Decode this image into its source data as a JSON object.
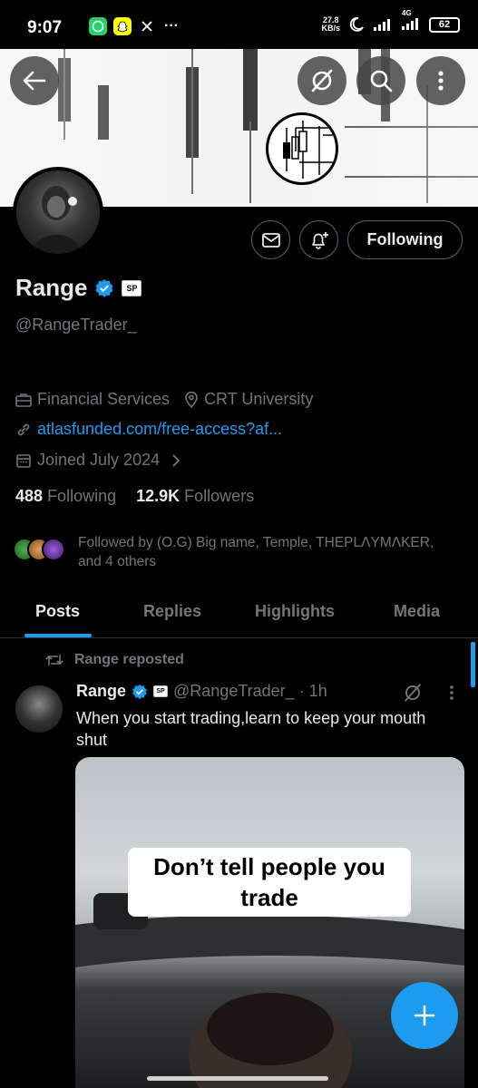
{
  "status_bar": {
    "time": "9:07",
    "speed_value": "27.8",
    "speed_unit": "KB/s",
    "network": "4G",
    "battery": "62",
    "apps": [
      "whatsapp-icon",
      "snapchat-icon",
      "x-icon"
    ],
    "more": "···"
  },
  "profile": {
    "name": "Range",
    "affiliate_badge": "SP",
    "handle": "@RangeTrader_",
    "category": "Financial Services",
    "location": "CRT University",
    "website": "atlasfunded.com/free-access?af...",
    "joined": "Joined July 2024",
    "following_count": "488",
    "following_label": "Following",
    "followers_count": "12.9K",
    "followers_label": "Followers",
    "followed_by": "Followed by (O.G) Big name, Temple, THEPLΛYMΛKER, and 4 others"
  },
  "actions": {
    "follow_label": "Following"
  },
  "tabs": [
    {
      "label": "Posts"
    },
    {
      "label": "Replies"
    },
    {
      "label": "Highlights"
    },
    {
      "label": "Media"
    }
  ],
  "post": {
    "repost_label": "Range reposted",
    "author": "Range",
    "handle_time": "@RangeTrader_ · 1h",
    "text": "When you start trading,learn to keep your mouth shut",
    "media_caption_line1": "Don’t tell people you",
    "media_caption_line2": "trade"
  },
  "colors": {
    "accent": "#1d9bf0",
    "background": "#000000",
    "secondary_text": "#71767b",
    "primary_text": "#e7e9ea"
  }
}
